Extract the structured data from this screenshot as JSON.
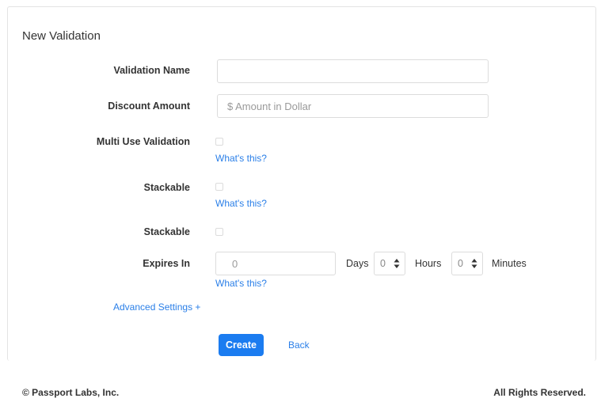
{
  "form": {
    "title": "New Validation",
    "validation_name": {
      "label": "Validation Name",
      "value": "",
      "placeholder": ""
    },
    "discount_amount": {
      "label": "Discount Amount",
      "value": "",
      "placeholder": "$ Amount in Dollar"
    },
    "multi_use": {
      "label": "Multi Use Validation",
      "checked": false,
      "help": "What's this?"
    },
    "stackable_1": {
      "label": "Stackable",
      "checked": false,
      "help": "What's this?"
    },
    "stackable_2": {
      "label": "Stackable",
      "checked": false
    },
    "expires": {
      "label": "Expires In",
      "days_placeholder": "0",
      "days_unit": "Days",
      "hours_value": "0",
      "hours_unit": "Hours",
      "minutes_value": "0",
      "minutes_unit": "Minutes",
      "help": "What's this?"
    },
    "advanced_settings": "Advanced Settings +",
    "create_label": "Create",
    "back_label": "Back"
  },
  "footer": {
    "copyright": "© Passport Labs, Inc.",
    "rights": "All Rights Reserved."
  },
  "colors": {
    "accent": "#1b7cf0",
    "link": "#2a7fe8",
    "border": "#dcdcdc"
  }
}
